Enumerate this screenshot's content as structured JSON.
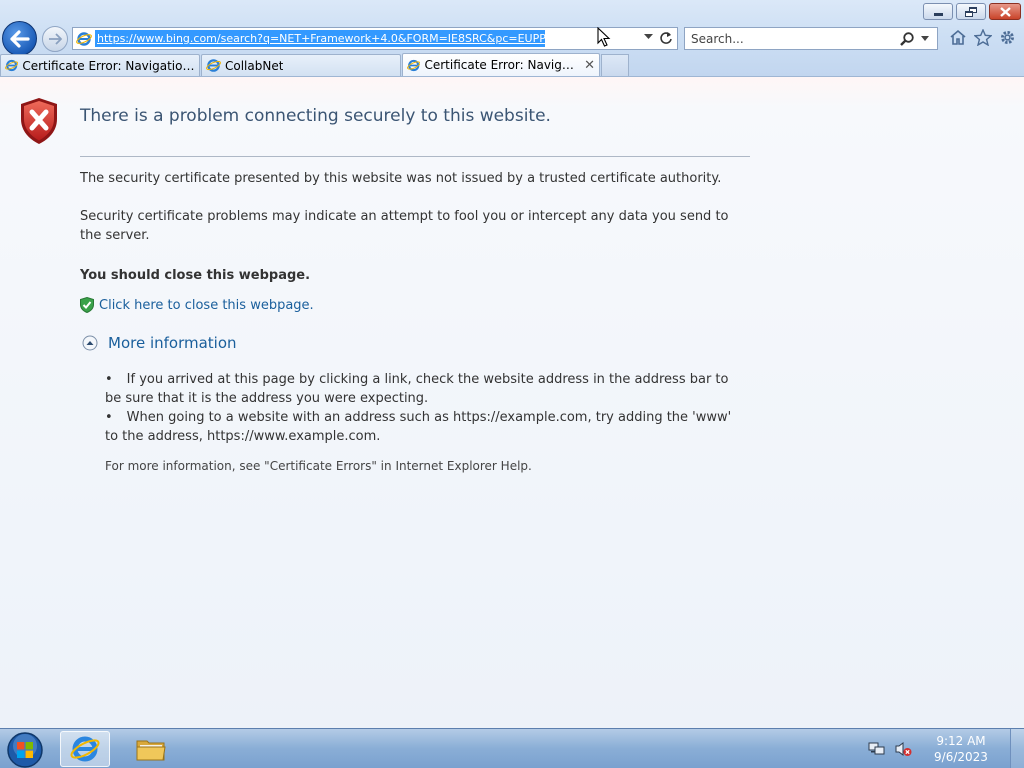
{
  "window": {
    "address_url": "https://www.bing.com/search?q=NET+Framework+4.0&FORM=IE8SRC&pc=EUPP_",
    "search_placeholder": "Search..."
  },
  "tabs": [
    {
      "label": "Certificate Error: Navigation Bl...",
      "active": false
    },
    {
      "label": "CollabNet",
      "active": false
    },
    {
      "label": "Certificate Error: Navigatio...",
      "active": true,
      "close": "✕"
    }
  ],
  "page": {
    "title": "There is a problem connecting securely to this website.",
    "paragraph1": "The security certificate presented by this website was not issued by a trusted certificate authority.",
    "paragraph2": "Security certificate problems may indicate an attempt to fool you or intercept any data you send to the server.",
    "recommendation": "You should close this webpage.",
    "close_link": "Click here to close this webpage.",
    "more_info_label": "More information",
    "bullets": [
      "If you arrived at this page by clicking a link, check the website address in the address bar to be sure that it is the address you were expecting.",
      "When going to a website with an address such as https://example.com, try adding the 'www' to the address, https://www.example.com."
    ],
    "footnote": "For more information, see \"Certificate Errors\" in Internet Explorer Help."
  },
  "taskbar": {
    "time": "9:12 AM",
    "date": "9/6/2023"
  },
  "icons": {
    "back": "back-arrow-icon",
    "forward": "forward-arrow-icon",
    "refresh": "refresh-icon",
    "search": "magnifier-icon",
    "home": "home-icon",
    "favorites": "star-icon",
    "tools": "gear-icon",
    "error_shield": "shield-error-icon",
    "close_shield": "shield-check-icon",
    "expand": "collapse-arrow-icon"
  },
  "colors": {
    "link": "#1a5f9c",
    "title": "#3b5573",
    "url_highlight": "#3399ff",
    "shield_red": "#c62828"
  }
}
